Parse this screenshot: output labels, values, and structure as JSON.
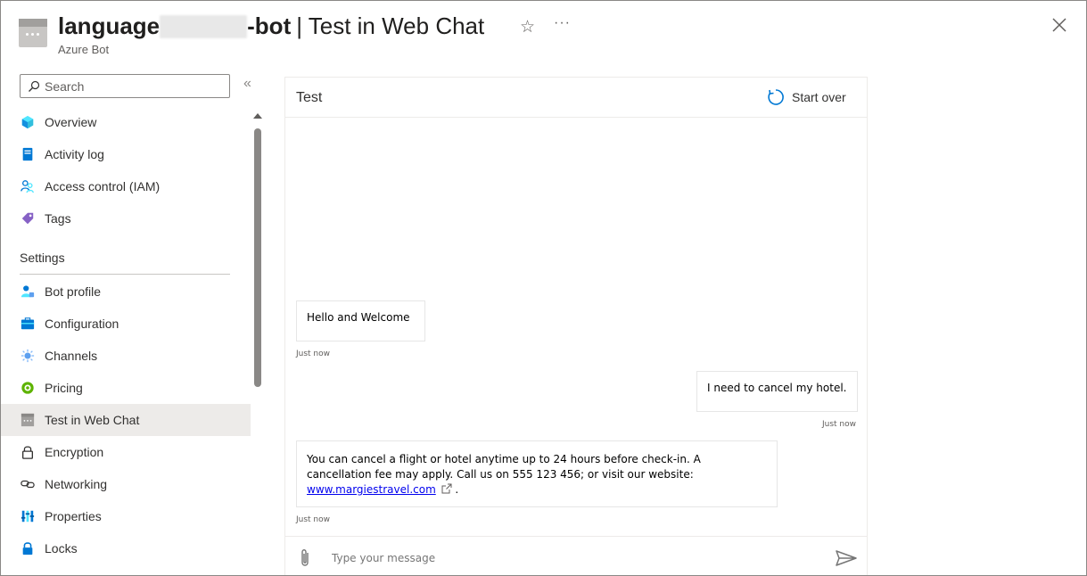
{
  "header": {
    "title_prefix": "language",
    "title_suffix": "-bot",
    "title_rest": "| Test in Web Chat",
    "subtitle": "Azure Bot",
    "more_label": "···"
  },
  "sidebar": {
    "search_placeholder": "Search",
    "collapse_label": "«",
    "items_top": [
      {
        "label": "Overview",
        "icon": "overview-icon"
      },
      {
        "label": "Activity log",
        "icon": "activity-log-icon"
      },
      {
        "label": "Access control (IAM)",
        "icon": "access-control-icon"
      },
      {
        "label": "Tags",
        "icon": "tag-icon"
      }
    ],
    "section_label": "Settings",
    "items_settings": [
      {
        "label": "Bot profile",
        "icon": "bot-profile-icon"
      },
      {
        "label": "Configuration",
        "icon": "configuration-icon"
      },
      {
        "label": "Channels",
        "icon": "channels-icon"
      },
      {
        "label": "Pricing",
        "icon": "pricing-icon"
      },
      {
        "label": "Test in Web Chat",
        "icon": "web-chat-icon",
        "active": true
      },
      {
        "label": "Encryption",
        "icon": "lock-outline-icon"
      },
      {
        "label": "Networking",
        "icon": "networking-icon"
      },
      {
        "label": "Properties",
        "icon": "properties-icon"
      },
      {
        "label": "Locks",
        "icon": "lock-icon"
      }
    ]
  },
  "chat": {
    "title": "Test",
    "start_over_label": "Start over",
    "messages": [
      {
        "from": "bot",
        "text": "Hello and Welcome",
        "time": "Just now"
      },
      {
        "from": "user",
        "text": "I need to cancel my hotel.",
        "time": "Just now"
      },
      {
        "from": "bot",
        "text_line1": "You can cancel a flight or hotel anytime up to 24 hours before check-in. A",
        "text_line2": "cancellation fee may apply. Call us on 555 123 456; or visit our website:",
        "link": "www.margiestravel.com",
        "after_link": ".",
        "time": "Just now"
      }
    ],
    "input_placeholder": "Type your message"
  },
  "colors": {
    "accent": "#0078d4",
    "active_nav_bg": "#edebe9",
    "link": "#0000ee"
  }
}
